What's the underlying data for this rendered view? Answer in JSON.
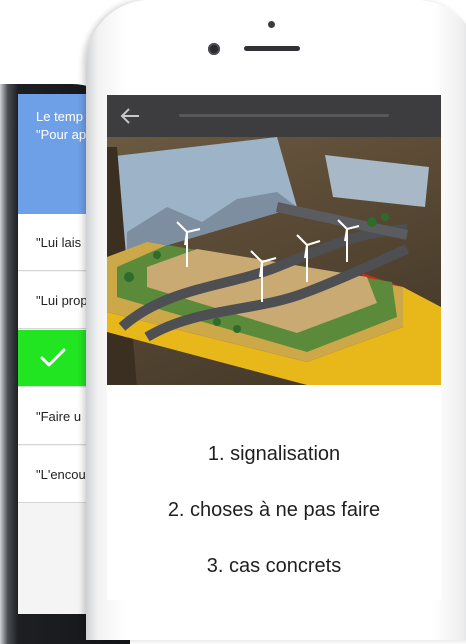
{
  "back_screen": {
    "header_lines": [
      "Le temp",
      "\"Pour ap"
    ],
    "items": [
      "\"Lui lais",
      "\"Lui prop",
      "",
      "\"Faire u",
      "\"L'encou"
    ],
    "correct_index": 2,
    "correct_color": "#22e522",
    "header_color": "#6ea0e8"
  },
  "front_screen": {
    "app_bar_color": "#3d3d3f",
    "back_icon": "arrow-left-icon",
    "hero_image": "toy road diorama with wind turbines in a yellow box",
    "list": [
      "1. signalisation",
      "2. choses à ne pas faire",
      "3. cas concrets"
    ]
  }
}
